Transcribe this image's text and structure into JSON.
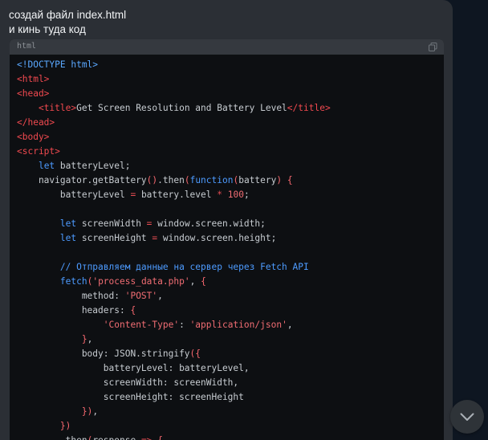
{
  "message": {
    "line1": "создай файл index.html",
    "line2": "и кинь туда код"
  },
  "code_block": {
    "language": "html",
    "lines": [
      [
        [
          "t-doctype",
          "<!DOCTYPE html>"
        ]
      ],
      [
        [
          "t-tag",
          "<html>"
        ]
      ],
      [
        [
          "t-tag",
          "<head>"
        ]
      ],
      [
        [
          "t-plain",
          "    "
        ],
        [
          "t-tag",
          "<title>"
        ],
        [
          "t-plain",
          "Get Screen Resolution and Battery Level"
        ],
        [
          "t-tag",
          "</title>"
        ]
      ],
      [
        [
          "t-tag",
          "</head>"
        ]
      ],
      [
        [
          "t-tag",
          "<body>"
        ]
      ],
      [
        [
          "t-tag",
          "<script>"
        ]
      ],
      [
        [
          "t-plain",
          "    "
        ],
        [
          "t-kw",
          "let"
        ],
        [
          "t-plain",
          " batteryLevel;"
        ]
      ],
      [
        [
          "t-plain",
          "    navigator.getBattery"
        ],
        [
          "t-punc",
          "()"
        ],
        [
          "t-plain",
          ".then"
        ],
        [
          "t-punc",
          "("
        ],
        [
          "t-kw",
          "function"
        ],
        [
          "t-punc",
          "("
        ],
        [
          "t-plain",
          "battery"
        ],
        [
          "t-punc",
          ")"
        ],
        [
          "t-plain",
          " "
        ],
        [
          "t-punc",
          "{"
        ]
      ],
      [
        [
          "t-plain",
          "        batteryLevel "
        ],
        [
          "t-op",
          "="
        ],
        [
          "t-plain",
          " battery.level "
        ],
        [
          "t-op",
          "*"
        ],
        [
          "t-plain",
          " "
        ],
        [
          "t-num",
          "100"
        ],
        [
          "t-plain",
          ";"
        ]
      ],
      [
        [
          "t-plain",
          ""
        ]
      ],
      [
        [
          "t-plain",
          "        "
        ],
        [
          "t-kw",
          "let"
        ],
        [
          "t-plain",
          " screenWidth "
        ],
        [
          "t-op",
          "="
        ],
        [
          "t-plain",
          " window.screen.width;"
        ]
      ],
      [
        [
          "t-plain",
          "        "
        ],
        [
          "t-kw",
          "let"
        ],
        [
          "t-plain",
          " screenHeight "
        ],
        [
          "t-op",
          "="
        ],
        [
          "t-plain",
          " window.screen.height;"
        ]
      ],
      [
        [
          "t-plain",
          ""
        ]
      ],
      [
        [
          "t-plain",
          "        "
        ],
        [
          "t-comment",
          "// Отправляем данные на сервер через Fetch API"
        ]
      ],
      [
        [
          "t-plain",
          "        "
        ],
        [
          "t-kw",
          "fetch"
        ],
        [
          "t-punc",
          "("
        ],
        [
          "t-str",
          "'process_data.php'"
        ],
        [
          "t-plain",
          ", "
        ],
        [
          "t-punc",
          "{"
        ]
      ],
      [
        [
          "t-plain",
          "            method: "
        ],
        [
          "t-str",
          "'POST'"
        ],
        [
          "t-plain",
          ","
        ]
      ],
      [
        [
          "t-plain",
          "            headers: "
        ],
        [
          "t-punc",
          "{"
        ]
      ],
      [
        [
          "t-plain",
          "                "
        ],
        [
          "t-str",
          "'Content-Type'"
        ],
        [
          "t-plain",
          ": "
        ],
        [
          "t-str",
          "'application/json'"
        ],
        [
          "t-plain",
          ","
        ]
      ],
      [
        [
          "t-plain",
          "            "
        ],
        [
          "t-punc",
          "}"
        ],
        [
          "t-plain",
          ","
        ]
      ],
      [
        [
          "t-plain",
          "            body: JSON.stringify"
        ],
        [
          "t-punc",
          "({"
        ]
      ],
      [
        [
          "t-plain",
          "                batteryLevel: batteryLevel,"
        ]
      ],
      [
        [
          "t-plain",
          "                screenWidth: screenWidth,"
        ]
      ],
      [
        [
          "t-plain",
          "                screenHeight: screenHeight"
        ]
      ],
      [
        [
          "t-plain",
          "            "
        ],
        [
          "t-punc",
          "})"
        ],
        [
          "t-plain",
          ","
        ]
      ],
      [
        [
          "t-plain",
          "        "
        ],
        [
          "t-punc",
          "})"
        ]
      ],
      [
        [
          "t-plain",
          "        .then"
        ],
        [
          "t-punc",
          "("
        ],
        [
          "t-plain",
          "response "
        ],
        [
          "t-op",
          "=>"
        ],
        [
          "t-plain",
          " "
        ],
        [
          "t-punc",
          "{"
        ]
      ]
    ]
  },
  "colors": {
    "background": "#0e1621",
    "bubble": "#2b2f35",
    "code_background": "#0d0f12",
    "code_header": "#35393f",
    "tag": "#f0494f",
    "keyword": "#4d9bff",
    "string": "#f16d73"
  },
  "icons": {
    "copy": "copy-icon",
    "scroll_down": "chevron-down-icon"
  }
}
